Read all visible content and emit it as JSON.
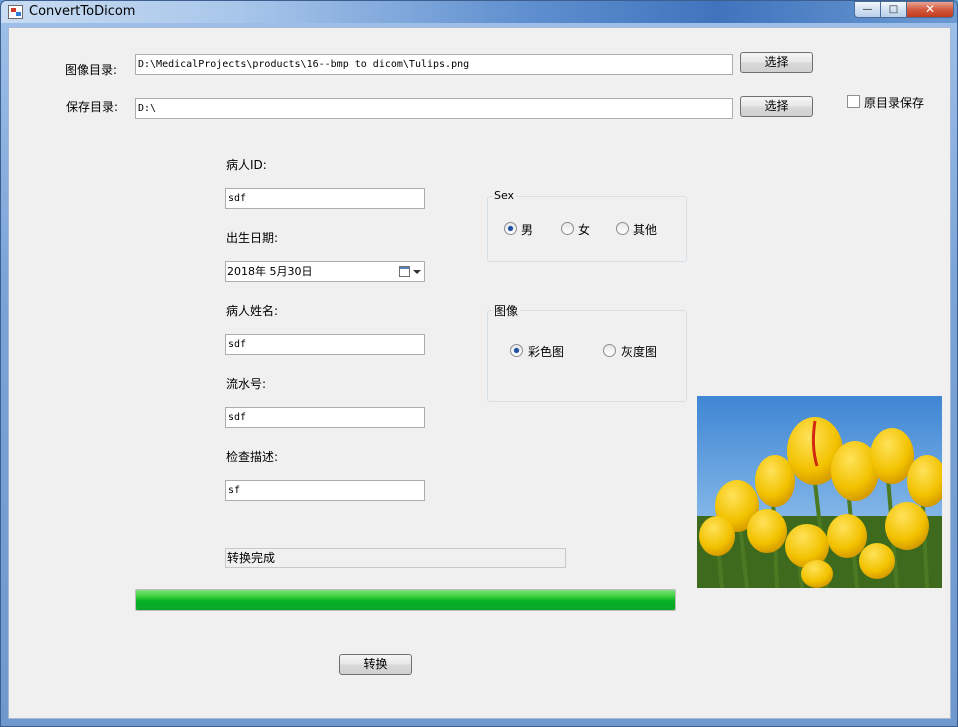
{
  "window": {
    "title": "ConvertToDicom",
    "minimize": "—",
    "maximize": "□",
    "close": "✕"
  },
  "paths": {
    "image_label": "图像目录:",
    "image_value": "D:\\MedicalProjects\\products\\16--bmp to dicom\\Tulips.png",
    "image_browse": "选择",
    "save_label": "保存目录:",
    "save_value": "D:\\",
    "save_browse": "选择",
    "original_dir_label": "原目录保存",
    "original_dir_checked": false
  },
  "form": {
    "patient_id_label": "病人ID:",
    "patient_id_value": "sdf",
    "birth_label": "出生日期:",
    "birth_value": "2018年  5月30日",
    "name_label": "病人姓名:",
    "name_value": "sdf",
    "serial_label": "流水号:",
    "serial_value": "sdf",
    "desc_label": "检查描述:",
    "desc_value": "sf"
  },
  "sex_group": {
    "title": "Sex",
    "options": [
      "男",
      "女",
      "其他"
    ],
    "selected": "男"
  },
  "image_group": {
    "title": "图像",
    "options": [
      "彩色图",
      "灰度图"
    ],
    "selected": "彩色图"
  },
  "status": {
    "text": "转换完成",
    "progress": 1.0
  },
  "convert_button": "转换",
  "colors": {
    "progress_green": "#06b025",
    "radio_dot": "#1c4fa1",
    "tulip_yellow": "#f2c200",
    "sky_blue": "#6fa8dc"
  }
}
